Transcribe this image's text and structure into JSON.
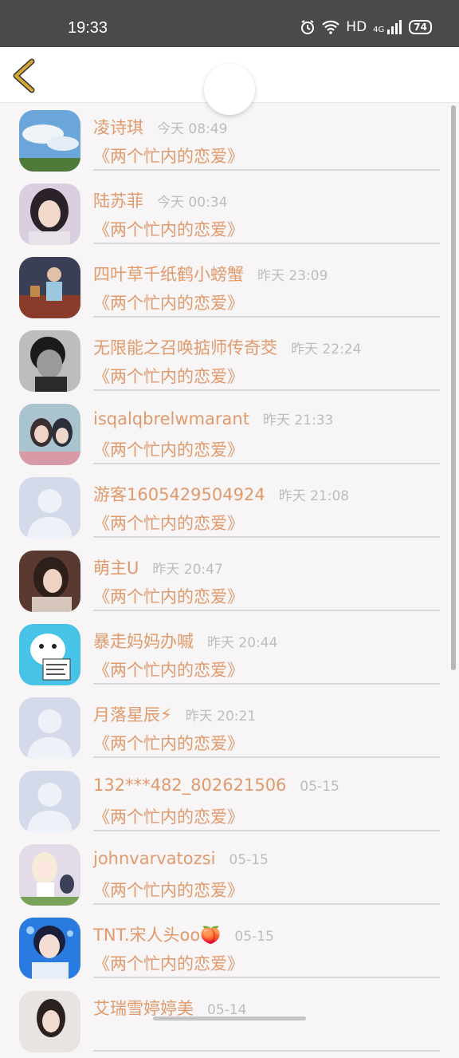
{
  "status_bar": {
    "time": "19:33",
    "network": "HD",
    "cell": "4G",
    "battery": "74"
  },
  "header": {
    "title": "",
    "colors": {
      "accent": "#e09a6c",
      "back": "#d4a537"
    }
  },
  "items": [
    {
      "name": "凌诗琪",
      "time": "今天 08:49",
      "book": "《两个忙内的恋爱》",
      "avatar": "sky"
    },
    {
      "name": "陆苏菲",
      "time": "今天 00:34",
      "book": "《两个忙内的恋爱》",
      "avatar": "girl"
    },
    {
      "name": "四叶草千纸鹤小螃蟹",
      "time": "昨天 23:09",
      "book": "《两个忙内的恋爱》",
      "avatar": "boy"
    },
    {
      "name": "无限能之召唤掂师传奇茭",
      "time": "昨天 22:24",
      "book": "《两个忙内的恋爱》",
      "avatar": "bw"
    },
    {
      "name": "isqalqbrelwmarant",
      "time": "昨天 21:33",
      "book": "《两个忙内的恋爱》",
      "avatar": "anime"
    },
    {
      "name": "游客1605429504924",
      "time": "昨天 21:08",
      "book": "《两个忙内的恋爱》",
      "avatar": "default"
    },
    {
      "name": "萌主U",
      "time": "昨天 20:47",
      "book": "《两个忙内的恋爱》",
      "avatar": "girl2"
    },
    {
      "name": "暴走妈妈办嘁",
      "time": "昨天 20:44",
      "book": "《两个忙内的恋爱》",
      "avatar": "dog"
    },
    {
      "name": "月落星辰⚡",
      "time": "昨天 20:21",
      "book": "《两个忙内的恋爱》",
      "avatar": "default"
    },
    {
      "name": "132***482_802621506",
      "time": "05-15",
      "book": "《两个忙内的恋爱》",
      "avatar": "default"
    },
    {
      "name": "johnvarvatozsi",
      "time": "05-15",
      "book": "《两个忙内的恋爱》",
      "avatar": "anime2"
    },
    {
      "name": "TNT.宋人头oo🍑",
      "time": "05-15",
      "book": "《两个忙内的恋爱》",
      "avatar": "boy2"
    },
    {
      "name": "艾瑞雪婷婷美",
      "time": "05-14",
      "book": "",
      "avatar": "girl3"
    }
  ]
}
